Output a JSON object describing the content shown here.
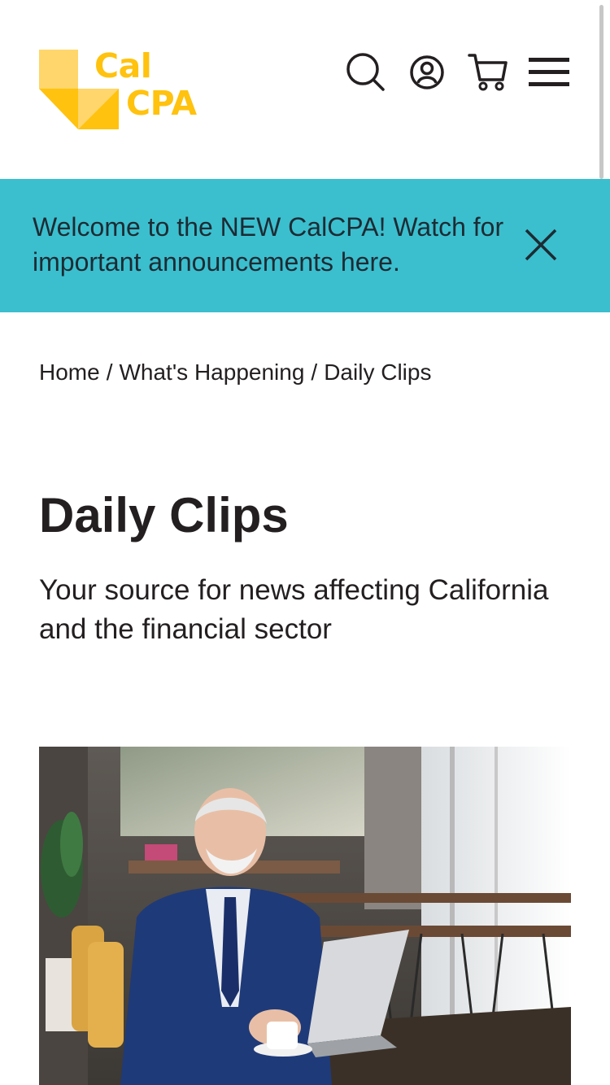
{
  "header": {
    "logo": {
      "line1": "Cal",
      "line2": "CPA",
      "alt": "CalCPA",
      "colors": {
        "yellow": "#ffc20e",
        "light_yellow": "#ffd66b"
      }
    },
    "actions": [
      {
        "icon": "search-icon",
        "label": "Search"
      },
      {
        "icon": "account-icon",
        "label": "Account"
      },
      {
        "icon": "cart-icon",
        "label": "Cart"
      },
      {
        "icon": "menu-icon",
        "label": "Menu"
      }
    ]
  },
  "banner": {
    "message": "Welcome to the NEW CalCPA! Watch for important announcements here.",
    "close_icon": "close-icon",
    "background": "#3bbfcf"
  },
  "breadcrumb": {
    "items": [
      "Home",
      "What's Happening",
      "Daily Clips"
    ],
    "separator": "/"
  },
  "page": {
    "title": "Daily Clips",
    "subtitle": "Your source for news affecting California and the financial sector"
  },
  "hero_image": {
    "alt": "Senior businessman in a blue suit drinking coffee while working on a laptop in a cafe"
  }
}
